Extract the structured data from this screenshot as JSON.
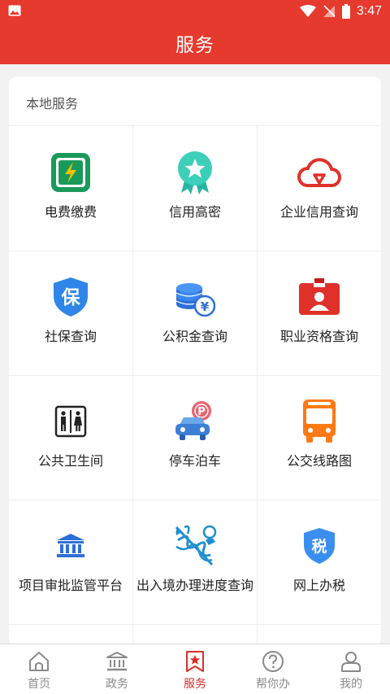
{
  "status_bar": {
    "time": "3:47"
  },
  "header": {
    "title": "服务"
  },
  "section": {
    "title": "本地服务",
    "items": [
      {
        "label": "电费缴费",
        "icon": "electricity-bill-icon"
      },
      {
        "label": "信用高密",
        "icon": "credit-badge-icon"
      },
      {
        "label": "企业信用查询",
        "icon": "cloud-check-icon"
      },
      {
        "label": "社保查询",
        "icon": "social-security-shield-icon"
      },
      {
        "label": "公积金查询",
        "icon": "coins-yuan-icon"
      },
      {
        "label": "职业资格查询",
        "icon": "id-badge-icon"
      },
      {
        "label": "公共卫生间",
        "icon": "restroom-icon"
      },
      {
        "label": "停车泊车",
        "icon": "parking-car-icon"
      },
      {
        "label": "公交线路图",
        "icon": "bus-icon"
      },
      {
        "label": "项目审批监管平台",
        "icon": "government-building-icon"
      },
      {
        "label": "出入境办理进度查询",
        "icon": "caduceus-icon"
      },
      {
        "label": "网上办税",
        "icon": "tax-shield-icon"
      }
    ]
  },
  "tabbar": {
    "items": [
      {
        "label": "首页",
        "icon": "home-icon",
        "active": false
      },
      {
        "label": "政务",
        "icon": "government-icon",
        "active": false
      },
      {
        "label": "服务",
        "icon": "service-star-icon",
        "active": true
      },
      {
        "label": "帮你办",
        "icon": "question-icon",
        "active": false
      },
      {
        "label": "我的",
        "icon": "user-icon",
        "active": false
      }
    ]
  },
  "colors": {
    "brand_red": "#e63a2e",
    "active_tab": "#d7302a",
    "inactive_tab": "#8a8a8a"
  }
}
